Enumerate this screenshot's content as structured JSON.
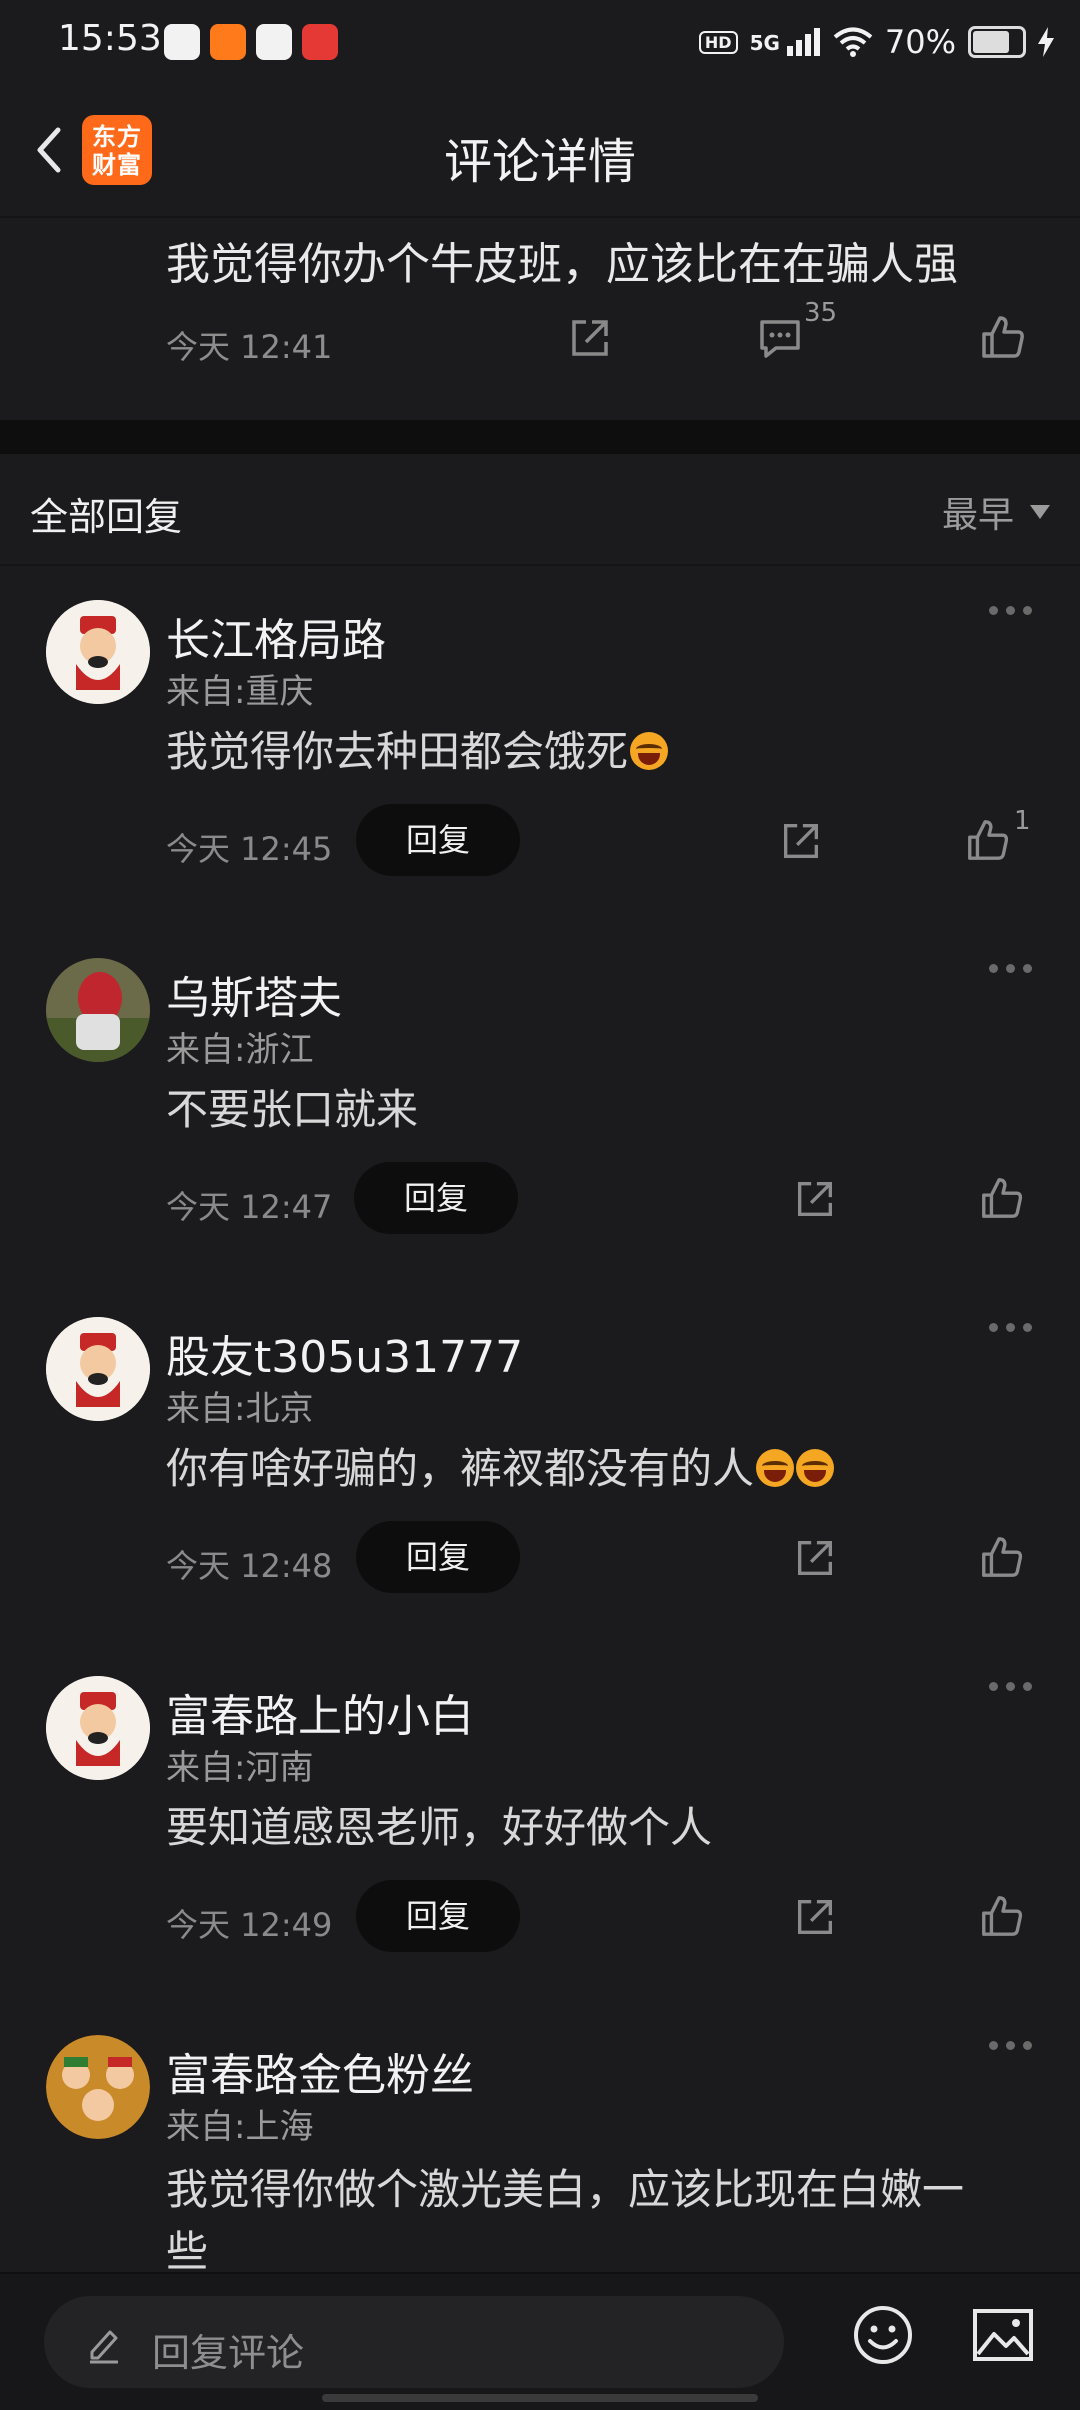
{
  "status_bar": {
    "time": "15:53",
    "network": "5G",
    "hd": "HD",
    "battery": "70%",
    "battery_level": 0.7
  },
  "nav": {
    "title": "评论详情",
    "logo_line1": "东方",
    "logo_line2": "财富"
  },
  "original_comment": {
    "text": "我觉得你办个牛皮班，应该比在在骗人强",
    "time": "今天 12:41",
    "reply_count": "35"
  },
  "section": {
    "title": "全部回复",
    "sort_label": "最早"
  },
  "reply_label": "回复",
  "comments": [
    {
      "name": "长江格局路",
      "location": "来自:重庆",
      "content": "我觉得你去种田都会饿死",
      "time": "今天 12:45",
      "likes": "1"
    },
    {
      "name": "乌斯塔夫",
      "location": "来自:浙江",
      "content": "不要张口就来",
      "time": "今天 12:47",
      "likes": ""
    },
    {
      "name": "股友t305u31777",
      "location": "来自:北京",
      "content": "你有啥好骗的，裤衩都没有的人",
      "time": "今天 12:48",
      "likes": ""
    },
    {
      "name": "富春路上的小白",
      "location": "来自:河南",
      "content": "要知道感恩老师，好好做个人",
      "time": "今天 12:49",
      "likes": ""
    },
    {
      "name": "富春路金色粉丝",
      "location": "来自:上海",
      "content_line1": "我觉得你做个激光美白，应该比现在白嫩一",
      "content_line2": "些"
    }
  ],
  "bottom_bar": {
    "placeholder": "回复评论"
  },
  "colors": {
    "background": "#1b1b1d",
    "brand": "#ff6a1a",
    "reply_button": "#0d0d0e"
  }
}
